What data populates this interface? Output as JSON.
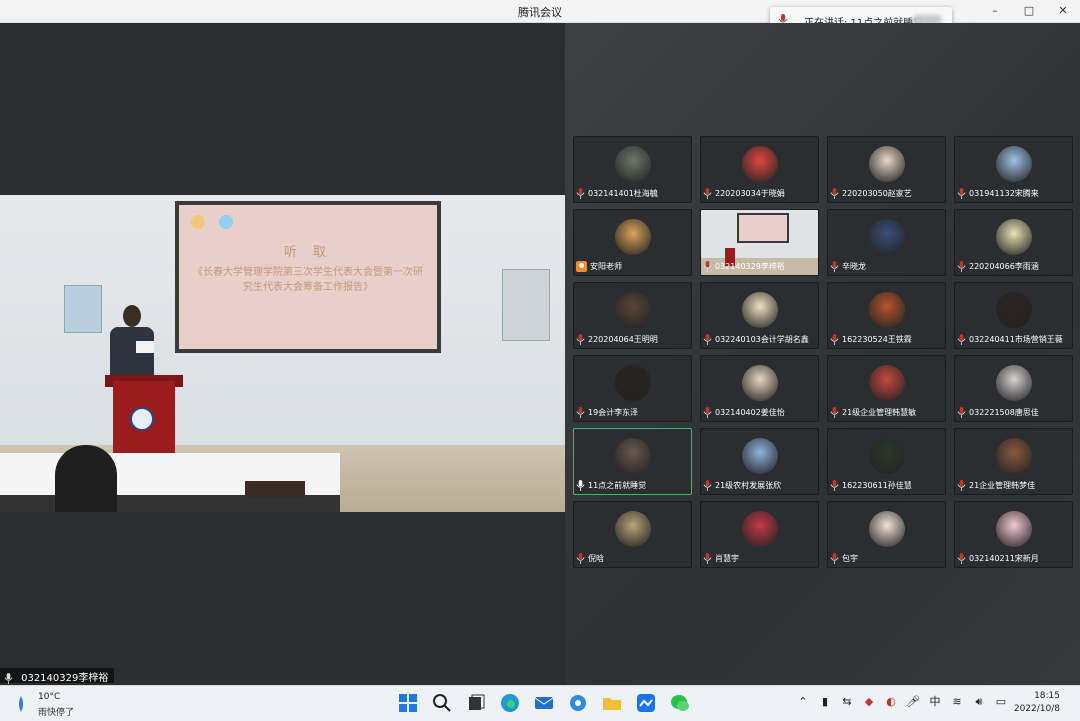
{
  "window": {
    "title": "腾讯会议",
    "minimize": "–",
    "maximize": "□",
    "close": "✕"
  },
  "speaking_indicator": {
    "label": "正在讲话: 11点之前就睡觉"
  },
  "main_stage": {
    "speaker_name": "032140329李梓裕",
    "projector_line1": "听 取",
    "projector_line2": "《长春大学管理学院第三次学生代表大会暨第一次研究生代表大会筹备工作报告》"
  },
  "participants": [
    {
      "name": "032141401杜海毓",
      "avatar_color": "#6a7a6a"
    },
    {
      "name": "220203034于晓娟",
      "avatar_color": "#e0493f"
    },
    {
      "name": "220203050赵家艺",
      "avatar_color": "#e8d6c8"
    },
    {
      "name": "031941132宋腾来",
      "avatar_color": "#9fc2e6"
    },
    {
      "name": "安阳老师",
      "avatar_color": "#d9a35a",
      "profile": true
    },
    {
      "name": "032140329李梓裕",
      "video": true
    },
    {
      "name": "辛晓龙",
      "avatar_color": "#3a4f7a"
    },
    {
      "name": "220204066李雨涵",
      "avatar_color": "#e8e2b4"
    },
    {
      "name": "220204064王明明",
      "avatar_color": "#5a4538"
    },
    {
      "name": "032240103会计学胡名鑫",
      "avatar_color": "#f0e0c0"
    },
    {
      "name": "162230524王铁霖",
      "avatar_color": "#b8552d"
    },
    {
      "name": "032240411市场营销王薇",
      "avatar_color": "#2e2522"
    },
    {
      "name": "19会计李东泽",
      "avatar_color": "#2a2422"
    },
    {
      "name": "032140402姜佳怡",
      "avatar_color": "#e9d6c2"
    },
    {
      "name": "21级企业管理韩慧敏",
      "avatar_color": "#c44a3e"
    },
    {
      "name": "032221508唐思佳",
      "avatar_color": "#d7d3d2"
    },
    {
      "name": "11点之前就睡觉",
      "avatar_color": "#6a5a50",
      "active": true
    },
    {
      "name": "21级农村发展张欣",
      "avatar_color": "#8fb3e0"
    },
    {
      "name": "162230611孙佳慧",
      "avatar_color": "#2b3a2b"
    },
    {
      "name": "21企业管理韩梦佳",
      "avatar_color": "#8a5a40"
    },
    {
      "name": "倪晗",
      "avatar_color": "#b8a47a"
    },
    {
      "name": "肖慧宇",
      "avatar_color": "#c43a4a"
    },
    {
      "name": "包宇",
      "avatar_color": "#f2e2d6"
    },
    {
      "name": "032140211宋新月",
      "avatar_color": "#f4c8d4"
    }
  ],
  "taskbar": {
    "temperature": "10°C",
    "weather": "雨快停了",
    "ime": "中",
    "time": "18:15",
    "date": "2022/10/8"
  }
}
